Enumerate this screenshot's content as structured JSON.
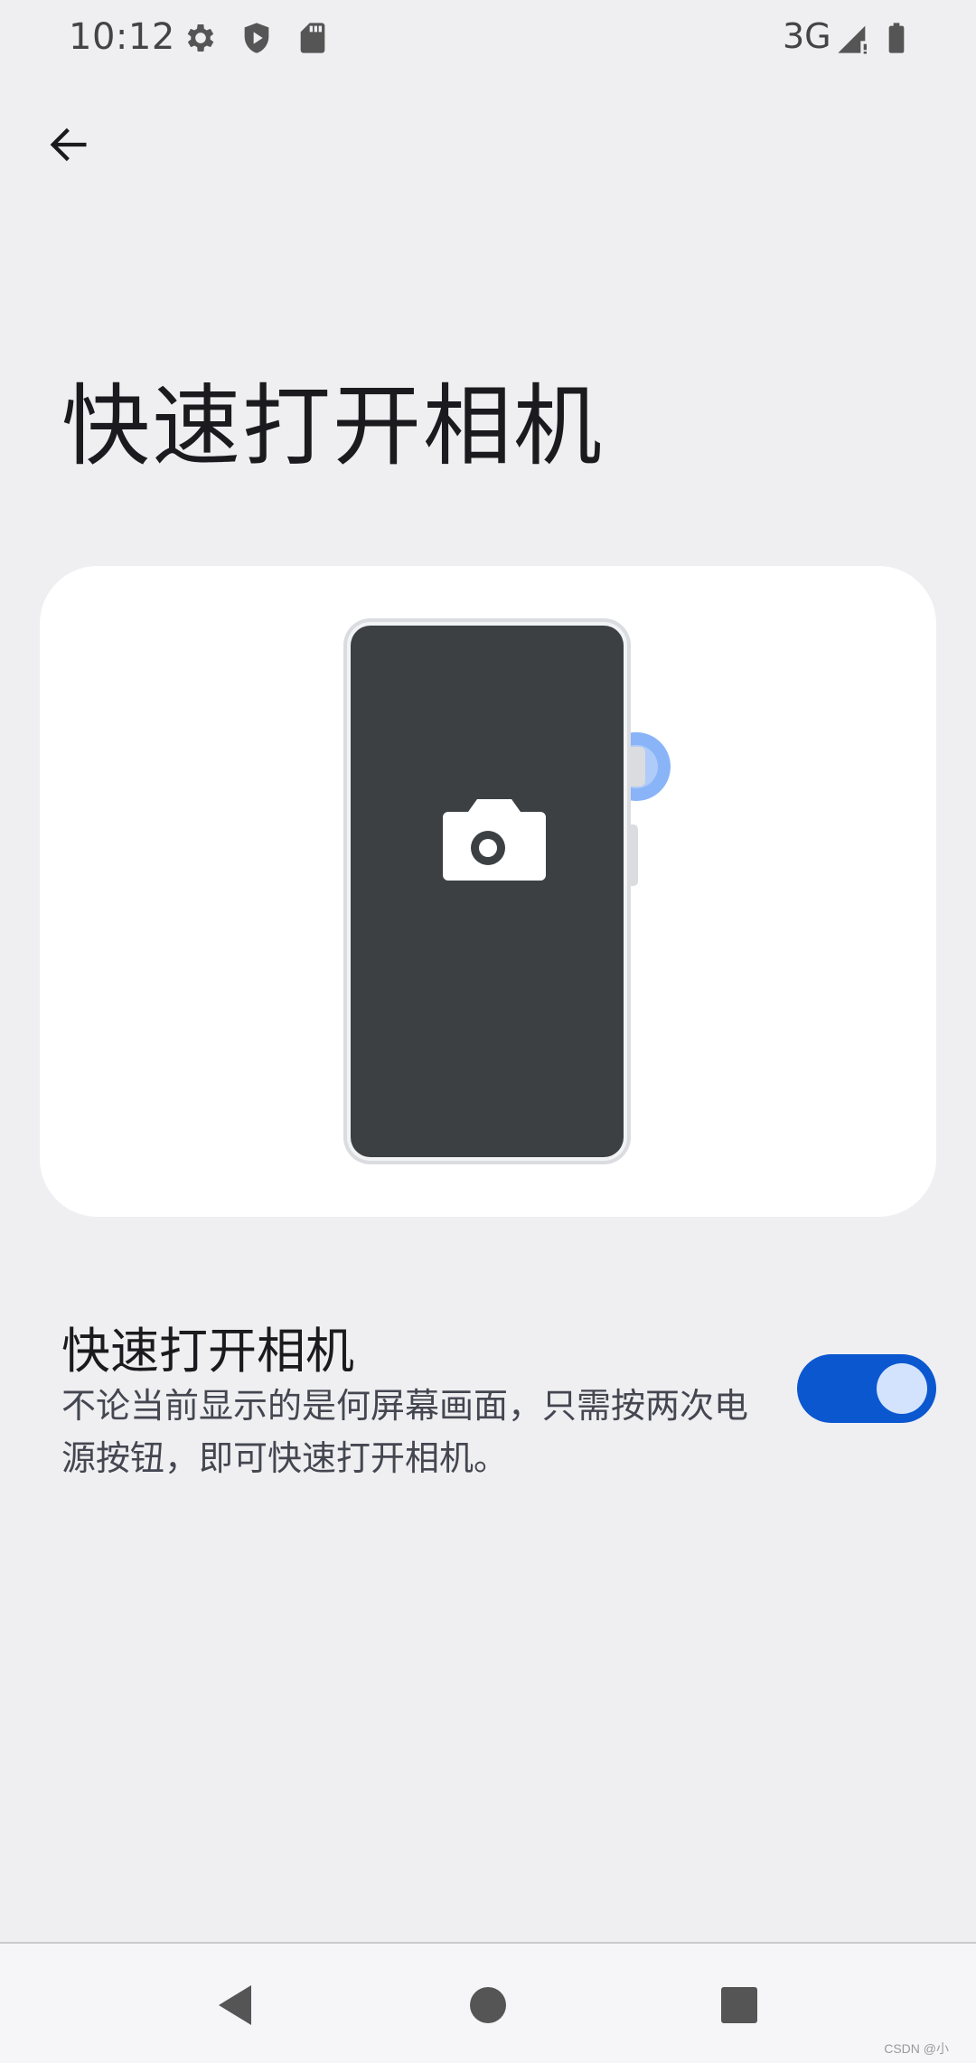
{
  "status_bar": {
    "time": "10:12",
    "network": "3G",
    "icons": [
      "gear-icon",
      "shield-icon",
      "sd-card-icon",
      "signal-icon",
      "battery-icon"
    ]
  },
  "header": {
    "back_icon": "arrow-back-icon",
    "title": "快速打开相机"
  },
  "illustration": {
    "phone_screen_color": "#3c4043",
    "accent_color": "#8ab4f8",
    "icon": "camera-icon"
  },
  "setting": {
    "title": "快速打开相机",
    "description": "不论当前显示的是何屏幕画面，只需按两次电源按钮，即可快速打开相机。",
    "enabled": true,
    "toggle_color": "#0b57d0"
  },
  "nav_bar": {
    "buttons": [
      "back-triangle-icon",
      "home-circle-icon",
      "recents-square-icon"
    ]
  },
  "watermark": "CSDN @小"
}
